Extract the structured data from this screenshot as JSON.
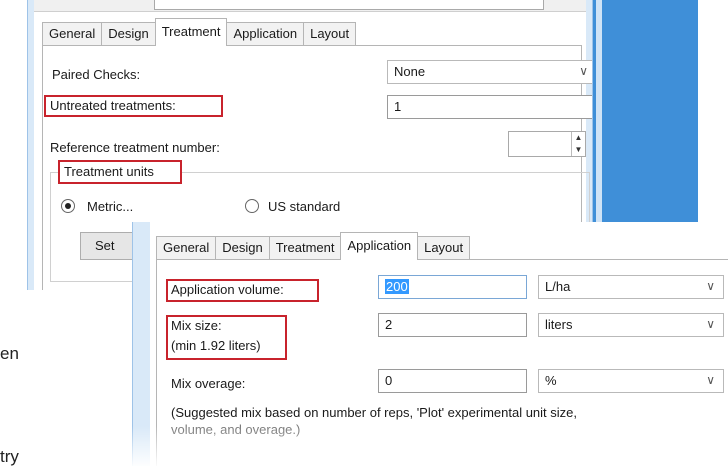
{
  "background": {
    "frag_en": "en",
    "frag_try": "try"
  },
  "treatment_dialog": {
    "tabs": [
      {
        "label": "General",
        "active": false
      },
      {
        "label": "Design",
        "active": false
      },
      {
        "label": "Treatment",
        "active": true
      },
      {
        "label": "Application",
        "active": false
      },
      {
        "label": "Layout",
        "active": false
      }
    ],
    "paired_checks": {
      "label": "Paired Checks:",
      "value": "None"
    },
    "untreated": {
      "label": "Untreated treatments:",
      "value": "1"
    },
    "reference": {
      "label": "Reference treatment number:",
      "value": ""
    },
    "units": {
      "group_label": "Treatment units",
      "metric_label": "Metric...",
      "us_label": "US standard",
      "selected": "metric",
      "button_label": "Set"
    }
  },
  "application_dialog": {
    "tabs": [
      {
        "label": "General",
        "active": false
      },
      {
        "label": "Design",
        "active": false
      },
      {
        "label": "Treatment",
        "active": false
      },
      {
        "label": "Application",
        "active": true
      },
      {
        "label": "Layout",
        "active": false
      }
    ],
    "app_volume": {
      "label": "Application volume:",
      "value": "200",
      "unit": "L/ha"
    },
    "mix_size": {
      "label_line1": "Mix size:",
      "label_line2": "(min 1.92 liters)",
      "value": "2",
      "unit": "liters"
    },
    "mix_overage": {
      "label": "Mix overage:",
      "value": "0",
      "unit": "%"
    },
    "note_line1": "(Suggested mix based on number of reps, 'Plot' experimental unit size,",
    "note_line2": "volume, and overage.)"
  },
  "colors": {
    "highlight_red": "#c8232c",
    "window_blue": "#3f8fd8",
    "selection_blue": "#3399ff"
  },
  "icons": {
    "dropdown": "chevron-down-icon",
    "spinner": "spinner-arrows-icon"
  }
}
